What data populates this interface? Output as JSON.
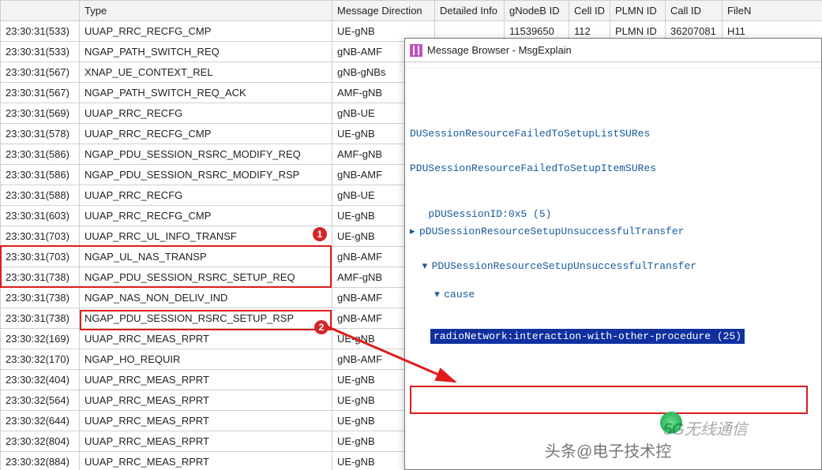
{
  "table": {
    "headers": [
      "",
      "Type",
      "Message Direction",
      "Detailed Info",
      "gNodeB ID",
      "Cell ID",
      "PLMN ID",
      "Call ID",
      "FileN"
    ],
    "rows": [
      {
        "ts": "23:30:31(533)",
        "type": "UUAP_RRC_RECFG_CMP",
        "dir": "UE-gNB",
        "det": "",
        "gnb": "11539650",
        "cell": "112",
        "plmn": "PLMN ID",
        "call": "36207081",
        "file": "H11"
      },
      {
        "ts": "23:30:31(533)",
        "type": "NGAP_PATH_SWITCH_REQ",
        "dir": "gNB-AMF",
        "det": "",
        "gnb": "",
        "cell": "",
        "plmn": "",
        "call": "",
        "file": ""
      },
      {
        "ts": "23:30:31(567)",
        "type": "XNAP_UE_CONTEXT_REL",
        "dir": "gNB-gNBs",
        "det": "",
        "gnb": "",
        "cell": "",
        "plmn": "",
        "call": "",
        "file": ""
      },
      {
        "ts": "23:30:31(567)",
        "type": "NGAP_PATH_SWITCH_REQ_ACK",
        "dir": "AMF-gNB",
        "det": "",
        "gnb": "",
        "cell": "",
        "plmn": "",
        "call": "",
        "file": ""
      },
      {
        "ts": "23:30:31(569)",
        "type": "UUAP_RRC_RECFG",
        "dir": "gNB-UE",
        "det": "",
        "gnb": "",
        "cell": "",
        "plmn": "",
        "call": "",
        "file": ""
      },
      {
        "ts": "23:30:31(578)",
        "type": "UUAP_RRC_RECFG_CMP",
        "dir": "UE-gNB",
        "det": "",
        "gnb": "",
        "cell": "",
        "plmn": "",
        "call": "",
        "file": ""
      },
      {
        "ts": "23:30:31(586)",
        "type": "NGAP_PDU_SESSION_RSRC_MODIFY_REQ",
        "dir": "AMF-gNB",
        "det": "",
        "gnb": "",
        "cell": "",
        "plmn": "",
        "call": "",
        "file": ""
      },
      {
        "ts": "23:30:31(586)",
        "type": "NGAP_PDU_SESSION_RSRC_MODIFY_RSP",
        "dir": "gNB-AMF",
        "det": "",
        "gnb": "",
        "cell": "",
        "plmn": "",
        "call": "",
        "file": ""
      },
      {
        "ts": "23:30:31(588)",
        "type": "UUAP_RRC_RECFG",
        "dir": "gNB-UE",
        "det": "",
        "gnb": "",
        "cell": "",
        "plmn": "",
        "call": "",
        "file": ""
      },
      {
        "ts": "23:30:31(603)",
        "type": "UUAP_RRC_RECFG_CMP",
        "dir": "UE-gNB",
        "det": "",
        "gnb": "",
        "cell": "",
        "plmn": "",
        "call": "",
        "file": ""
      },
      {
        "ts": "23:30:31(703)",
        "type": "UUAP_RRC_UL_INFO_TRANSF",
        "dir": "UE-gNB",
        "det": "",
        "gnb": "",
        "cell": "",
        "plmn": "",
        "call": "",
        "file": ""
      },
      {
        "ts": "23:30:31(703)",
        "type": "NGAP_UL_NAS_TRANSP",
        "dir": "gNB-AMF",
        "det": "",
        "gnb": "",
        "cell": "",
        "plmn": "",
        "call": "",
        "file": ""
      },
      {
        "ts": "23:30:31(738)",
        "type": "NGAP_PDU_SESSION_RSRC_SETUP_REQ",
        "dir": "AMF-gNB",
        "det": "",
        "gnb": "",
        "cell": "",
        "plmn": "",
        "call": "",
        "file": ""
      },
      {
        "ts": "23:30:31(738)",
        "type": "NGAP_NAS_NON_DELIV_IND",
        "dir": "gNB-AMF",
        "det": "",
        "gnb": "",
        "cell": "",
        "plmn": "",
        "call": "",
        "file": ""
      },
      {
        "ts": "23:30:31(738)",
        "type": "NGAP_PDU_SESSION_RSRC_SETUP_RSP",
        "dir": "gNB-AMF",
        "det": "",
        "gnb": "",
        "cell": "",
        "plmn": "",
        "call": "",
        "file": ""
      },
      {
        "ts": "23:30:32(169)",
        "type": "UUAP_RRC_MEAS_RPRT",
        "dir": "UE-gNB",
        "det": "",
        "gnb": "",
        "cell": "",
        "plmn": "",
        "call": "",
        "file": ""
      },
      {
        "ts": "23:30:32(170)",
        "type": "NGAP_HO_REQUIR",
        "dir": "gNB-AMF",
        "det": "",
        "gnb": "",
        "cell": "",
        "plmn": "",
        "call": "",
        "file": ""
      },
      {
        "ts": "23:30:32(404)",
        "type": "UUAP_RRC_MEAS_RPRT",
        "dir": "UE-gNB",
        "det": "",
        "gnb": "",
        "cell": "",
        "plmn": "",
        "call": "",
        "file": ""
      },
      {
        "ts": "23:30:32(564)",
        "type": "UUAP_RRC_MEAS_RPRT",
        "dir": "UE-gNB",
        "det": "",
        "gnb": "",
        "cell": "",
        "plmn": "",
        "call": "",
        "file": ""
      },
      {
        "ts": "23:30:32(644)",
        "type": "UUAP_RRC_MEAS_RPRT",
        "dir": "UE-gNB",
        "det": "",
        "gnb": "",
        "cell": "",
        "plmn": "",
        "call": "",
        "file": ""
      },
      {
        "ts": "23:30:32(804)",
        "type": "UUAP_RRC_MEAS_RPRT",
        "dir": "UE-gNB",
        "det": "",
        "gnb": "",
        "cell": "",
        "plmn": "",
        "call": "",
        "file": ""
      },
      {
        "ts": "23:30:32(884)",
        "type": "UUAP_RRC_MEAS_RPRT",
        "dir": "UE-gNB",
        "det": "",
        "gnb": "",
        "cell": "",
        "plmn": "",
        "call": "",
        "file": ""
      }
    ]
  },
  "badges": {
    "one": "1",
    "two": "2"
  },
  "browser": {
    "title": "Message Browser - MsgExplain",
    "line1": "DUSessionResourceFailedToSetupListSURes",
    "line2": "PDUSessionResourceFailedToSetupItemSURes",
    "line_pdu": "pDUSessionID:0x5 (5)",
    "line_transfer1": "pDUSessionResourceSetupUnsuccessfulTransfer",
    "line_transfer2": "PDUSessionResourceSetupUnsuccessfulTransfer",
    "line_cause": "cause",
    "selected": "radioNetwork:interaction-with-other-procedure (25)"
  },
  "watermark": {
    "line1": "5G无线通信",
    "line2": "头条@电子技术控"
  }
}
